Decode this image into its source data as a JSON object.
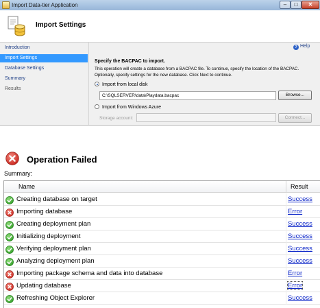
{
  "window": {
    "title": "Import Data-tier Application",
    "min_glyph": "–",
    "max_glyph": "□",
    "close_glyph": "✕"
  },
  "header": {
    "title": "Import Settings"
  },
  "nav": {
    "items": [
      {
        "label": "Introduction",
        "state": "link"
      },
      {
        "label": "Import Settings",
        "state": "selected"
      },
      {
        "label": "Database Settings",
        "state": "link"
      },
      {
        "label": "Summary",
        "state": "link"
      },
      {
        "label": "Results",
        "state": "disabled"
      }
    ]
  },
  "content": {
    "help_label": "Help",
    "heading": "Specify the BACPAC to import.",
    "description": "This operation will create a database from a BACPAC file. To continue, specify the location of the BACPAC. Optionally, specify settings for the new database. Click Next to continue.",
    "option_local": "Import from local disk",
    "local_path": "C:\\SQLSERVER\\data\\Playdata.bacpac",
    "browse_label": "Browse...",
    "option_azure": "Import from Windows Azure",
    "storage_label": "Storage account:",
    "storage_value": "",
    "connect_label": "Connect..."
  },
  "operation": {
    "title": "Operation Failed",
    "summary_label": "Summary:",
    "columns": {
      "name": "Name",
      "result": "Result"
    },
    "rows": [
      {
        "name": "Creating database on target",
        "result": "Success",
        "status": "success"
      },
      {
        "name": "Importing database",
        "result": "Error",
        "status": "error"
      },
      {
        "name": "Creating deployment plan",
        "result": "Success",
        "status": "success"
      },
      {
        "name": "Initializing deployment",
        "result": "Success",
        "status": "success"
      },
      {
        "name": "Verifying deployment plan",
        "result": "Success",
        "status": "success"
      },
      {
        "name": "Analyzing deployment plan",
        "result": "Success",
        "status": "success"
      },
      {
        "name": "Importing package schema and data into database",
        "result": "Error",
        "status": "error"
      },
      {
        "name": "Updating database",
        "result": "Error",
        "status": "error",
        "focused": true
      },
      {
        "name": "Refreshing Object Explorer",
        "result": "Success",
        "status": "success"
      }
    ]
  },
  "colors": {
    "selected_nav": "#3399ff",
    "link": "#1f3f86",
    "success_icon": "#3fa535",
    "error_icon": "#d9342b",
    "result_link": "#0a24c8"
  },
  "icons": {
    "app": "app-icon",
    "header": "database-import-icon",
    "help": "help-icon",
    "operation_failed": "error-icon",
    "success": "check-icon",
    "error": "error-icon"
  }
}
